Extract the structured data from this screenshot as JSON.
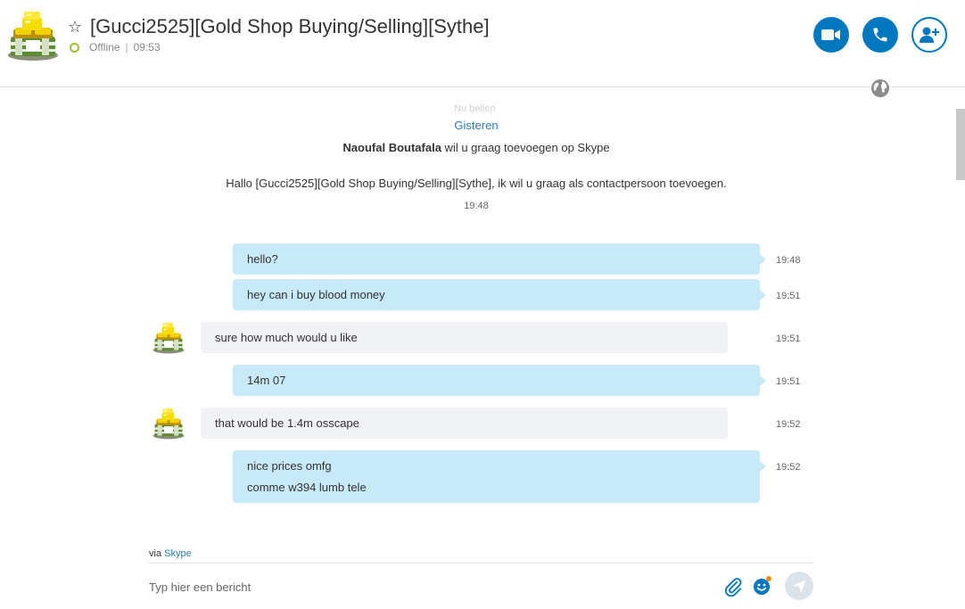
{
  "header": {
    "title": "[Gucci2525][Gold Shop Buying/Selling][Sythe]",
    "status": "Offline",
    "status_time": "09:53",
    "status_separator": "|"
  },
  "chat": {
    "faded_top_label": "Nu bellen",
    "date_separator": "Gisteren",
    "request_name": "Naoufal Boutafala",
    "request_text": " wil u graag toevoegen op Skype",
    "request_message": "Hallo [Gucci2525][Gold Shop Buying/Selling][Sythe], ik wil u graag als contactpersoon toevoegen.",
    "request_time": "19:48",
    "messages": [
      {
        "dir": "out",
        "lines": [
          "hello?"
        ],
        "time": "19:48"
      },
      {
        "dir": "out",
        "lines": [
          "hey can i buy blood money"
        ],
        "time": "19:51"
      },
      {
        "dir": "in",
        "lines": [
          "sure how much would u like"
        ],
        "time": "19:51"
      },
      {
        "dir": "out",
        "lines": [
          "14m 07"
        ],
        "time": "19:51"
      },
      {
        "dir": "in",
        "lines": [
          "that would be 1.4m osscape"
        ],
        "time": "19:52"
      },
      {
        "dir": "out",
        "lines": [
          "nice prices omfg",
          "comme w394 lumb tele"
        ],
        "time": "19:52"
      }
    ]
  },
  "footer": {
    "via_prefix": "via ",
    "via_link": "Skype",
    "compose_placeholder": "Typ hier een bericht"
  },
  "icons": {
    "video": "video-camera-icon",
    "call": "phone-icon",
    "add_people": "add-person-icon",
    "globe": "globe-icon",
    "attach": "paperclip-icon",
    "emoji": "emoji-icon",
    "send": "send-icon",
    "favorite": "star-icon"
  },
  "colors": {
    "accent": "#0078bf",
    "outgoing_bubble": "#c7e9fa",
    "incoming_bubble": "#f0f2f5",
    "status_ring": "#9bc12c",
    "link": "#2a7db5"
  }
}
